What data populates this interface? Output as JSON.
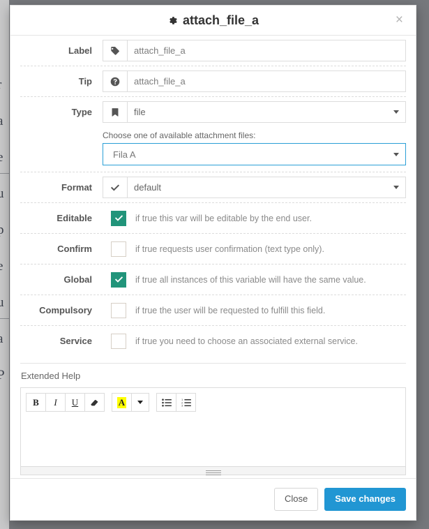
{
  "modal": {
    "title": "attach_file_a",
    "title_icon": "gear-icon",
    "close_label": "×"
  },
  "fields": [
    {
      "label": "Label",
      "icon": "tag-icon",
      "value": "attach_file_a",
      "kind": "text"
    },
    {
      "label": "Tip",
      "icon": "question-circle-icon",
      "value": "attach_file_a",
      "kind": "text"
    },
    {
      "label": "Type",
      "icon": "bookmark-icon",
      "value": "file",
      "kind": "select"
    }
  ],
  "attachment": {
    "label": "Choose one of available attachment files:",
    "value": "Fila A",
    "focus_color": "#2a9fd6"
  },
  "format": {
    "label": "Format",
    "icon": "check-icon",
    "value": "default"
  },
  "checkboxes": [
    {
      "label": "Editable",
      "checked": true,
      "desc": "if true this var will be editable by the end user."
    },
    {
      "label": "Confirm",
      "checked": false,
      "desc": "if true requests user confirmation (text type only)."
    },
    {
      "label": "Global",
      "checked": true,
      "desc": "if true all instances of this variable will have the same value."
    },
    {
      "label": "Compulsory",
      "checked": false,
      "desc": "if true the user will be requested to fulfill this field."
    },
    {
      "label": "Service",
      "checked": false,
      "desc": "if true you need to choose an associated external service."
    }
  ],
  "extended_help": {
    "title": "Extended Help",
    "content": "",
    "toolbar": [
      {
        "name": "bold-icon",
        "glyph": "B"
      },
      {
        "name": "italic-icon",
        "glyph": "I"
      },
      {
        "name": "underline-icon",
        "glyph": "U"
      },
      {
        "name": "eraser-icon",
        "glyph": ""
      },
      {
        "name": "highlight-color-icon",
        "glyph": "A"
      },
      {
        "name": "color-dropdown-icon",
        "glyph": ""
      },
      {
        "name": "unordered-list-icon",
        "glyph": ""
      },
      {
        "name": "ordered-list-icon",
        "glyph": ""
      }
    ]
  },
  "footer": {
    "close_label": "Close",
    "save_label": "Save changes"
  },
  "colors": {
    "checked_green": "#21947a",
    "primary_blue": "#2196d3",
    "highlight_yellow": "#ffff00",
    "overlay_gray": "#76787c"
  },
  "background_glyphs": "r\na\ne\nu\np\ne\nu\na\nP"
}
